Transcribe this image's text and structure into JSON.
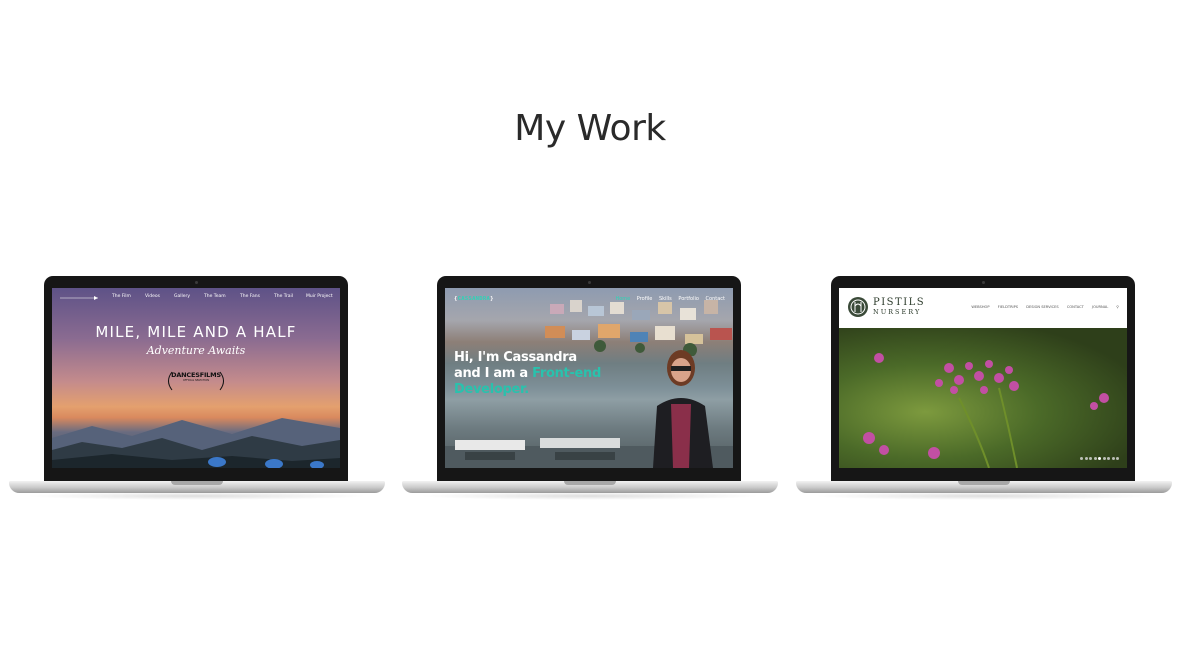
{
  "page": {
    "title": "My Work"
  },
  "projects": [
    {
      "nav": [
        "The Film",
        "Videos",
        "Gallery",
        "The Team",
        "The Fans",
        "The Trail",
        "Muir Project"
      ],
      "headline": "MILE, MILE AND A HALF",
      "tagline": "Adventure Awaits",
      "badge_line1": "DANCES",
      "badge_line2": "FILMS",
      "badge_small": "OFFICIAL SELECTION"
    },
    {
      "logo": "CASSANDRA",
      "nav": [
        "Home",
        "Profile",
        "Skills",
        "Portfolio",
        "Contact"
      ],
      "hero_line1": "Hi, I'm Cassandra",
      "hero_line2": "and I am a",
      "hero_accent1": "Front-end",
      "hero_accent2": "Developer.",
      "accent_color": "#29c2ad"
    },
    {
      "brand_line1": "PISTILS",
      "brand_line2": "NURSERY",
      "nav": [
        "WEBSHOP",
        "FIELDTRIPS",
        "DESIGN SERVICES",
        "CONTACT",
        "JOURNAL"
      ],
      "search_icon": "search-icon"
    }
  ]
}
